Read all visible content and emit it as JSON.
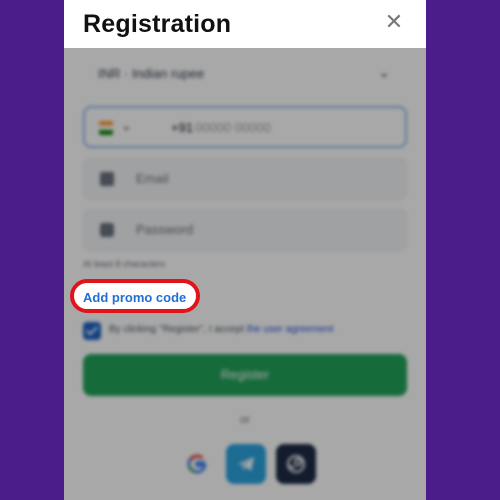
{
  "modal": {
    "title": "Registration",
    "close_icon": "close-icon"
  },
  "form": {
    "currency": "INR · Indian rupee",
    "country_code": "+91",
    "phone_placeholder": "00000 00000",
    "email_placeholder": "Email",
    "password_placeholder": "Password",
    "password_hint": "At least 8 characters",
    "agreement_prefix": "By clicking \"Register\", I accept",
    "agreement_link": "the user agreement",
    "register_label": "Register",
    "or_label": "or"
  },
  "promo": {
    "label": "Add promo code",
    "highlight_color": "#e0141a"
  },
  "social": [
    "google-icon",
    "telegram-icon",
    "steam-icon"
  ],
  "colors": {
    "background": "#4a1d8a",
    "accent": "#1f6fd6",
    "register": "#22a35a"
  }
}
